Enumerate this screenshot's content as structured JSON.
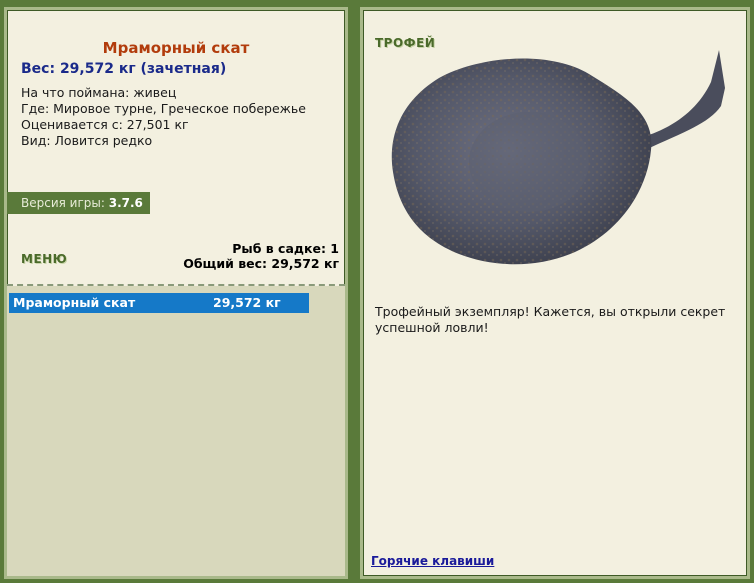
{
  "fish": {
    "name": "Мраморный скат",
    "weight_line": "Вес: 29,572 кг (зачетная)",
    "bait": "На что поймана: живец",
    "location": "Где: Мировое турне, Греческое побережье",
    "valued_from": "Оценивается с: 27,501 кг",
    "rarity": "Вид: Ловится редко"
  },
  "version": {
    "label": "Версия игры:",
    "value": "3.7.6"
  },
  "menu_label": "МЕНЮ",
  "keepnet": {
    "count_line": "Рыб в садке: 1",
    "total_line": "Общий вес: 29,572 кг"
  },
  "list": [
    {
      "name": "Мраморный скат",
      "weight": "29,572 кг"
    }
  ],
  "trophy": {
    "label": "ТРОФЕЙ",
    "message": "Трофейный экземпляр! Кажется, вы открыли секрет успешной ловли!"
  },
  "hotkeys_label": "Горячие клавиши",
  "colors": {
    "background": "#5a7a3a",
    "panel": "#f3f0e0",
    "title": "#b23c0c",
    "weight": "#1a2a8a",
    "selection": "#1579c8",
    "list_bg": "#d8d8bc"
  }
}
